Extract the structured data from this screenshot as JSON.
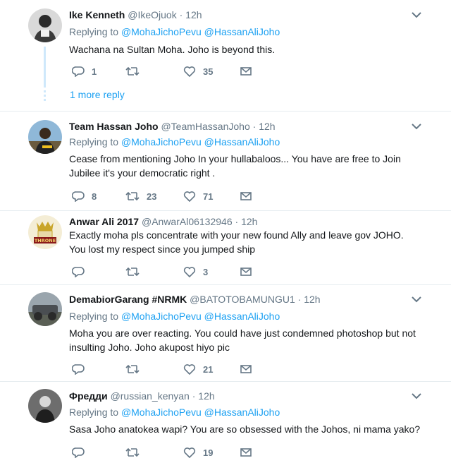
{
  "tweets": [
    {
      "name": "Ike Kenneth",
      "handle": "@IkeOjuok",
      "time": "12h",
      "replying_prefix": "Replying to",
      "mention1": "@MohaJichoPevu",
      "mention2": "@HassanAliJoho",
      "text": "Wachana na Sultan Moha.  Joho is beyond this.",
      "replies": "1",
      "retweets": "",
      "likes": "35"
    },
    {
      "name": "Team Hassan Joho",
      "handle": "@TeamHassanJoho",
      "time": "12h",
      "replying_prefix": "Replying to",
      "mention1": "@MohaJichoPevu",
      "mention2": "@HassanAliJoho",
      "text": "Cease  from mentioning Joho In your hullabaloos...  You have are free to Join Jubilee it's your democratic right .",
      "replies": "8",
      "retweets": "23",
      "likes": "71"
    },
    {
      "name": "Anwar Ali 2017",
      "handle": "@AnwarAl06132946",
      "time": "12h",
      "text": "Exactly moha pls concentrate with your new found Ally and leave gov JOHO. You lost my respect since you jumped ship",
      "replies": "",
      "retweets": "",
      "likes": "3"
    },
    {
      "name": "DemabiorGarang #NRMK",
      "handle": "@BATOTOBAMUNGU1",
      "time": "12h",
      "replying_prefix": "Replying to",
      "mention1": "@MohaJichoPevu",
      "mention2": "@HassanAliJoho",
      "text": "Moha you are over reacting. You could have just condemned photoshop but not insulting  Joho. Joho akupost hiyo pic",
      "replies": "",
      "retweets": "",
      "likes": "21"
    },
    {
      "name": "Фредди",
      "handle": "@russian_kenyan",
      "time": "12h",
      "replying_prefix": "Replying to",
      "mention1": "@MohaJichoPevu",
      "mention2": "@HassanAliJoho",
      "text": "Sasa Joho anatokea wapi? You are so obsessed with the Johos, ni mama yako?",
      "replies": "",
      "retweets": "",
      "likes": "19"
    }
  ],
  "more_replies_label": "1 more reply",
  "separator": "·",
  "avatar_badge_text": "THRONE",
  "colors": {
    "link": "#1da1f2",
    "muted": "#657786",
    "divider": "#e6ecf0",
    "thread": "#cfe8fb"
  }
}
